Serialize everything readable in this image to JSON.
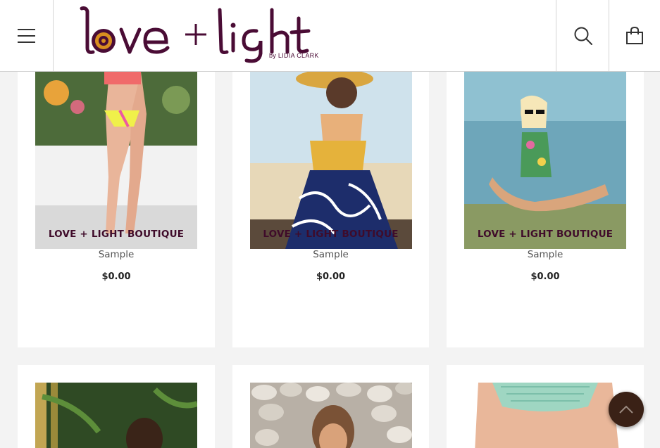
{
  "header": {
    "menu_icon": "hamburger-icon",
    "search_icon": "search-icon",
    "cart_icon": "shopping-bag-icon",
    "logo": {
      "word1": "love",
      "plus": "+",
      "word2": "light",
      "byline": "by LIDIA CLARK",
      "brand_color": "#4a0c35",
      "accent_color": "#d98e1f"
    }
  },
  "products": [
    {
      "brand": "LOVE + LIGHT BOUTIQUE",
      "title": "Sample",
      "price": "$0.00"
    },
    {
      "brand": "LOVE + LIGHT BOUTIQUE",
      "title": "Sample",
      "price": "$0.00"
    },
    {
      "brand": "LOVE + LIGHT BOUTIQUE",
      "title": "Sample",
      "price": "$0.00"
    },
    {
      "brand": "",
      "title": "",
      "price": ""
    },
    {
      "brand": "",
      "title": "",
      "price": ""
    },
    {
      "brand": "",
      "title": "",
      "price": ""
    }
  ],
  "scroll_top_icon": "chevron-up-icon",
  "colors": {
    "brand_text": "#3f0b2a",
    "scroll_button": "#3a2116"
  }
}
